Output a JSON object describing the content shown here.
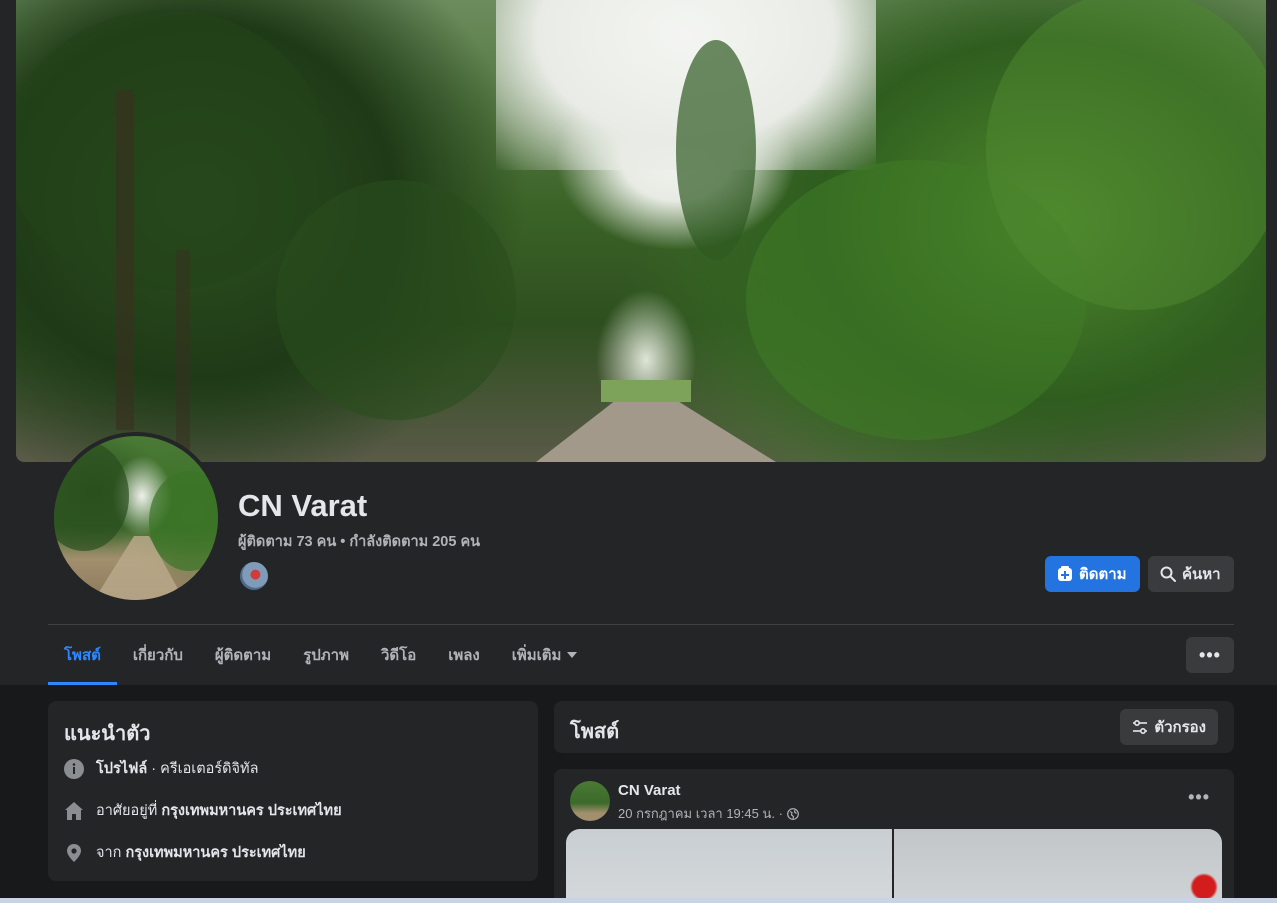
{
  "profile": {
    "name": "CN Varat",
    "followers_text": "ผู้ติดตาม 73 คน • กำลังติดตาม 205 คน"
  },
  "actions": {
    "follow_label": "ติดตาม",
    "search_label": "ค้นหา",
    "more_label": "•••"
  },
  "tabs": [
    {
      "label": "โพสต์",
      "active": true
    },
    {
      "label": "เกี่ยวกับ"
    },
    {
      "label": "ผู้ติดตาม"
    },
    {
      "label": "รูปภาพ"
    },
    {
      "label": "วิดีโอ"
    },
    {
      "label": "เพลง"
    },
    {
      "label": "เพิ่มเติม"
    }
  ],
  "intro": {
    "title": "แนะนำตัว",
    "profile_type": "โปรไฟล์",
    "profile_category": " · ครีเอเตอร์ดิจิทัล",
    "lives_prefix": "อาศัยอยู่ที่ ",
    "lives_place": "กรุงเทพมหานคร ประเทศไทย",
    "from_prefix": "จาก ",
    "from_place": "กรุงเทพมหานคร ประเทศไทย"
  },
  "posts": {
    "title": "โพสต์",
    "filter_label": "ตัวกรอง"
  },
  "post": {
    "author": "CN Varat",
    "meta": "20 กรกฎาคม เวลา 19:45 น. ·",
    "more_label": "•••"
  },
  "colors": {
    "accent": "#2374e1",
    "active_tab": "#2d88ff",
    "background": "#18191a",
    "card": "#242526"
  }
}
